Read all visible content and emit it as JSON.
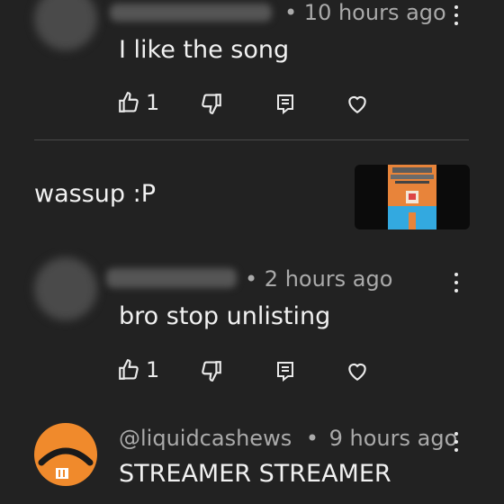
{
  "comments": [
    {
      "time": "10 hours ago",
      "text": "I like the song",
      "likes": "1"
    },
    {
      "time": "2 hours ago",
      "text": "bro stop unlisting",
      "likes": "1"
    },
    {
      "handle": "@liquidcashews",
      "time": "9 hours ago",
      "text": "STREAMER STREAMER"
    }
  ],
  "post": {
    "text": "wassup :P"
  },
  "separator": "•",
  "icons": [
    "like-icon",
    "dislike-icon",
    "reply-icon",
    "heart-icon",
    "more-vert-icon"
  ],
  "colors": {
    "background": "#222222",
    "text": "#f1f1f1",
    "meta": "#aaaaaa",
    "divider": "#4a4a4a",
    "thumb_orange": "#e8843a",
    "thumb_blue": "#33a9e0"
  }
}
